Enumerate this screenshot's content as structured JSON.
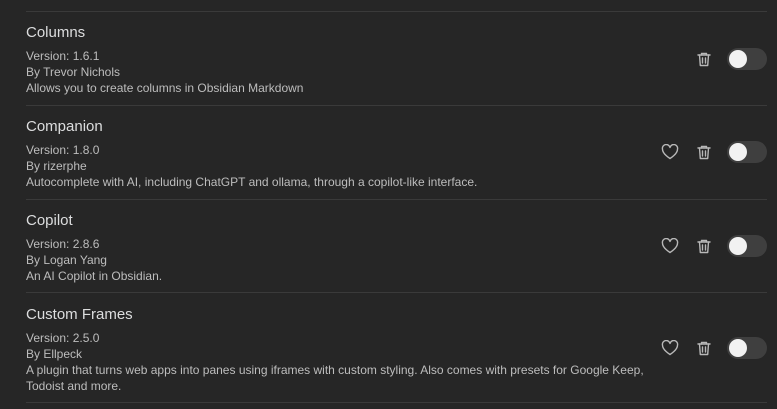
{
  "plugins": [
    {
      "name": "Columns",
      "version": "Version: 1.6.1",
      "author": "By Trevor Nichols",
      "description": "Allows you to create columns in Obsidian Markdown",
      "has_donate": false,
      "enabled": false
    },
    {
      "name": "Companion",
      "version": "Version: 1.8.0",
      "author": "By rizerphe",
      "description": "Autocomplete with AI, including ChatGPT and ollama, through a copilot-like interface.",
      "has_donate": true,
      "enabled": false
    },
    {
      "name": "Copilot",
      "version": "Version: 2.8.6",
      "author": "By Logan Yang",
      "description": "An AI Copilot in Obsidian.",
      "has_donate": true,
      "enabled": false
    },
    {
      "name": "Custom Frames",
      "version": "Version: 2.5.0",
      "author": "By Ellpeck",
      "description": "A plugin that turns web apps into panes using iframes with custom styling. Also comes with presets for Google Keep, Todoist and more.",
      "has_donate": true,
      "enabled": false
    }
  ],
  "icons": {
    "donate": "heart-icon",
    "uninstall": "trash-icon"
  },
  "colors": {
    "background": "#262626",
    "divider": "#3a3a3a",
    "toggle_off": "#3f3f3f",
    "knob": "#f2f2f2",
    "icon": "#b8b8b8"
  }
}
